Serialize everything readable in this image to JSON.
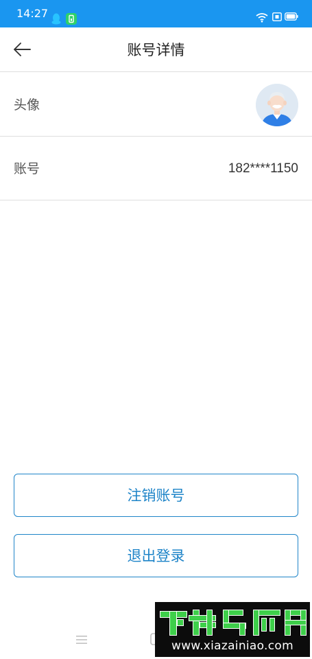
{
  "status_bar": {
    "time": "14:27",
    "icons": [
      "qq-icon",
      "app-notification-icon",
      "wifi-icon",
      "sim-icon",
      "battery-icon"
    ],
    "color": "#1a96f0"
  },
  "header": {
    "title": "账号详情",
    "back_icon": "arrow-left-icon"
  },
  "rows": {
    "avatar": {
      "label": "头像"
    },
    "account": {
      "label": "账号",
      "value": "182****1150"
    }
  },
  "buttons": {
    "cancel_account": "注销账号",
    "logout": "退出登录"
  },
  "watermark": {
    "url": "www.xiazainiao.com"
  },
  "colors": {
    "accent": "#1e84c8",
    "divider": "#dedede"
  }
}
